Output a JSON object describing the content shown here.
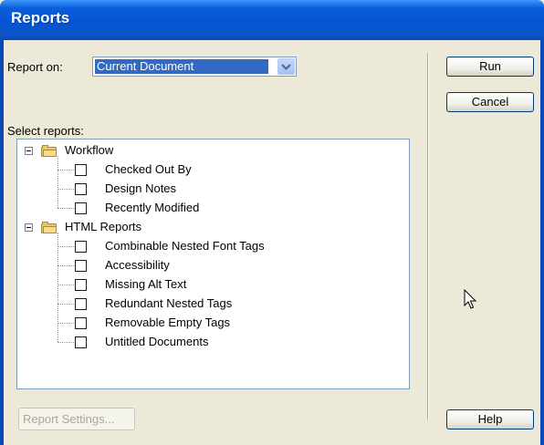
{
  "window": {
    "title": "Reports"
  },
  "report_on": {
    "label": "Report on:",
    "selected": "Current Document"
  },
  "select_reports_label": "Select reports:",
  "tree": {
    "groups": [
      {
        "label": "Workflow",
        "items": [
          "Checked Out By",
          "Design Notes",
          "Recently Modified"
        ]
      },
      {
        "label": "HTML Reports",
        "items": [
          "Combinable Nested Font Tags",
          "Accessibility",
          "Missing Alt Text",
          "Redundant Nested Tags",
          "Removable Empty Tags",
          "Untitled Documents"
        ]
      }
    ]
  },
  "buttons": {
    "run": "Run",
    "cancel": "Cancel",
    "help": "Help",
    "report_settings": "Report Settings..."
  },
  "colors": {
    "title_bar": "#0654d4",
    "selection": "#316ac5",
    "dialog_bg": "#ece9d8"
  }
}
